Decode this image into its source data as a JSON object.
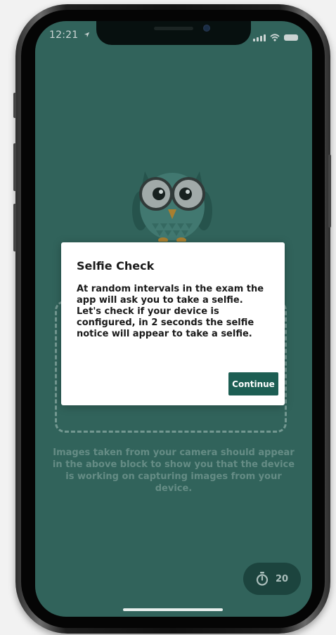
{
  "status_bar": {
    "time": "12:21"
  },
  "modal": {
    "title": "Selfie Check",
    "body": "At random intervals in the exam the app will ask you to take a selfie. Let's check if your device is configured, in 2 seconds the selfie notice will appear to take a selfie.",
    "continue_label": "Continue"
  },
  "camera_note": "Images taken from your camera should appear in the above block to show you that the device is working on capturing images from your device.",
  "timer": {
    "value": "20",
    "icon": "stopwatch-icon"
  },
  "colors": {
    "screen_bg": "#3a6f66",
    "accent": "#1d5e53",
    "timer_bg": "#1f4740"
  }
}
